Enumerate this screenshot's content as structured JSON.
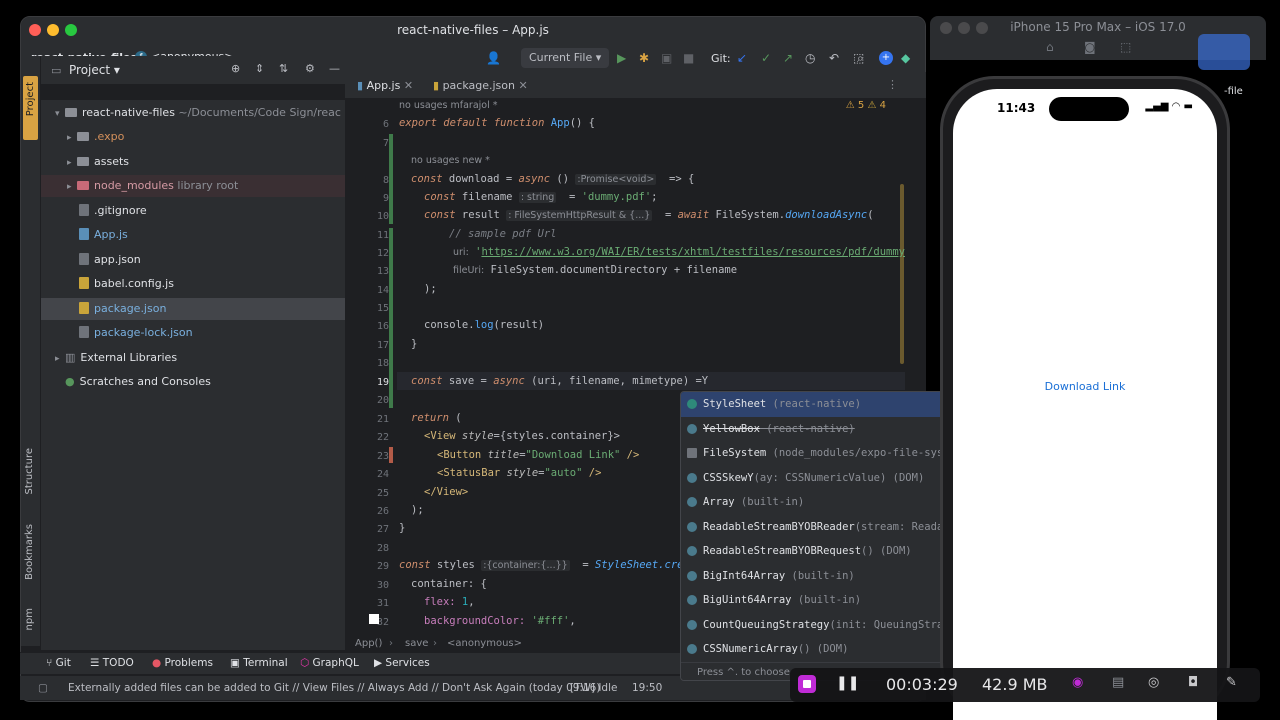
{
  "window": {
    "title": "react-native-files – App.js",
    "project_name": "react-native-files",
    "anon_crumb": "<anonymous>",
    "run_config": "Current File",
    "git_label": "Git:"
  },
  "project_panel": {
    "title": "Project",
    "items": [
      {
        "label": "react-native-files",
        "suffix": " ~/Documents/Code Sign/reac",
        "kind": "folder"
      },
      {
        "label": ".expo",
        "kind": "folder"
      },
      {
        "label": "assets",
        "kind": "folder"
      },
      {
        "label": "node_modules",
        "suffix": " library root",
        "kind": "folder"
      },
      {
        "label": ".gitignore",
        "kind": "file"
      },
      {
        "label": "App.js",
        "kind": "file"
      },
      {
        "label": "app.json",
        "kind": "file"
      },
      {
        "label": "babel.config.js",
        "kind": "file"
      },
      {
        "label": "package.json",
        "kind": "file"
      },
      {
        "label": "package-lock.json",
        "kind": "file"
      },
      {
        "label": "External Libraries",
        "kind": "lib"
      },
      {
        "label": "Scratches and Consoles",
        "kind": "scratch"
      }
    ]
  },
  "left_strip": {
    "structure": "Structure",
    "bookmarks": "Bookmarks",
    "npm": "npm"
  },
  "tabs": [
    {
      "label": "App.js"
    },
    {
      "label": "package.json"
    }
  ],
  "editor": {
    "usage_hint_top": "no usages   mfarajol *",
    "usage_hint_inner": "no usages   new *",
    "warnings": "5",
    "weak_warnings": "4",
    "line_numbers": [
      "6",
      "7",
      "8",
      "9",
      "10",
      "11",
      "12",
      "13",
      "14",
      "15",
      "16",
      "17",
      "18",
      "19",
      "20",
      "21",
      "22",
      "23",
      "24",
      "25",
      "26",
      "27",
      "28",
      "29",
      "30",
      "31",
      "32"
    ]
  },
  "code": {
    "l6_kw1": "export default function",
    "l6_fn": "App",
    "l6_rest": "() {",
    "l8_kw": "const",
    "l8_name": " download = ",
    "l8_async": "async",
    "l8_parens": " () ",
    "l8_hint": ":Promise<void>",
    "l8_arrow": "  => {",
    "l9_kw": "const",
    "l9_name": " filename ",
    "l9_hint": ": string",
    "l9_eq": "  = ",
    "l9_str": "'dummy.pdf'",
    "l9_end": ";",
    "l10_kw": "const",
    "l10_name": " result ",
    "l10_hint": ": FileSystemHttpResult & {...}",
    "l10_eq": "  = ",
    "l10_await": "await",
    "l10_obj": " FileSystem.",
    "l10_fn": "downloadAsync",
    "l10_paren": "(",
    "l11_cm": "// sample pdf Url",
    "l12_key": "uri:",
    "l12_q": " '",
    "l12_url": "https://www.w3.org/WAI/ER/tests/xhtml/testfiles/resources/pdf/dummy",
    "l13_key": "fileUri:",
    "l13_val": " FileSystem.documentDirectory + filename",
    "l14": ");",
    "l16_a": "console.",
    "l16_fn": "log",
    "l16_b": "(result)",
    "l17": "}",
    "l19_kw": "const",
    "l19_name": " save = ",
    "l19_async": "async",
    "l19_params": " (uri, filename, mimetype) =Y",
    "l21_kw": "return",
    "l21_rest": " (",
    "l22_tag": "<View",
    "l22_attr": " style",
    "l22_rest": "={styles.container}>",
    "l23_tag": "<Button",
    "l23_attr": " title",
    "l23_eq": "=",
    "l23_str": "\"Download Link\"",
    "l23_end": " />",
    "l24_tag": "<StatusBar",
    "l24_attr": " style",
    "l24_eq": "=",
    "l24_str": "\"auto\"",
    "l24_end": " />",
    "l25_tag": "</View>",
    "l26": ");",
    "l27": "}",
    "l29_kw": "const",
    "l29_name": " styles ",
    "l29_hint": ":{container:{...}}",
    "l29_eq": "  = ",
    "l29_fn": "StyleSheet.cre",
    "l30": "container: {",
    "l31_prop": "flex:",
    "l31_num": " 1",
    "l31_end": ",",
    "l32_prop": "backgroundColor:",
    "l32_str": " '#fff'",
    "l32_end": ","
  },
  "completion": {
    "items": [
      {
        "name": "StyleSheet",
        "detail": " (react-native)",
        "type": ""
      },
      {
        "name": "YellowBox",
        "detail": " (react-native)",
        "type": ""
      },
      {
        "name": "FileSystem",
        "detail": " (node_modules/expo-file-system/build)",
        "type": ""
      },
      {
        "name": "CSSSkewY",
        "detail": "(ay: CSSNumericValue) (DOM)",
        "type": "CSSSkewY"
      },
      {
        "name": "Array",
        "detail": " (built-in)",
        "type": ""
      },
      {
        "name": "ReadableStreamBYOBReader",
        "detail": "(stream: ReadableSt…",
        "type": "ReadableStreamBYOBReader"
      },
      {
        "name": "ReadableStreamBYOBRequest",
        "detail": "() (DOM)",
        "type": "ReadableStreamBYOBRequest"
      },
      {
        "name": "BigInt64Array",
        "detail": " (built-in)",
        "type": ""
      },
      {
        "name": "BigUint64Array",
        "detail": " (built-in)",
        "type": ""
      },
      {
        "name": "CountQueuingStrategy",
        "detail": "(init: QueuingStrategyInit)…",
        "type": "CountQueuingStrategy"
      },
      {
        "name": "CSSNumericArray",
        "detail": "() (DOM)",
        "type": "CSSNumericArray"
      }
    ],
    "footer": "Press ^. to choose"
  },
  "breadcrumb": {
    "a": "App()",
    "b": "save",
    "c": "<anonymous>"
  },
  "tool_windows": [
    "Git",
    "TODO",
    "Problems",
    "Terminal",
    "GraphQL",
    "Services"
  ],
  "status": {
    "message": "Externally added files can be added to Git // View Files // Always Add // Don't Ask Again (today 09:16)",
    "idle": "[TW] Idle",
    "position": "19:50"
  },
  "simulator": {
    "title": "iPhone 15 Pro Max – iOS 17.0",
    "clock": "11:43",
    "button_label": "Download Link",
    "side_label": "-file"
  },
  "recording": {
    "elapsed": "00:03:29",
    "size": "42.9 MB"
  },
  "colors": {
    "accent": "#3574f0",
    "link": "#1a6fd6",
    "keyword": "#cf8e6d",
    "string": "#6aab73",
    "function": "#56a8f5"
  }
}
